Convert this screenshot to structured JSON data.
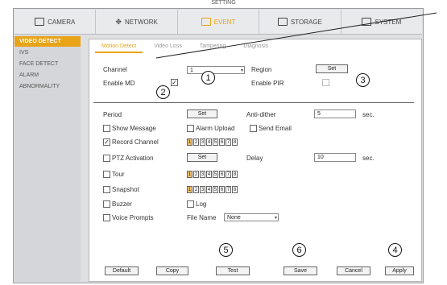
{
  "window_title": "SETTING",
  "top_tabs": [
    {
      "label": "CAMERA",
      "icon": "camera-icon",
      "active": false
    },
    {
      "label": "NETWORK",
      "icon": "network-icon",
      "active": false
    },
    {
      "label": "EVENT",
      "icon": "event-icon",
      "active": true
    },
    {
      "label": "STORAGE",
      "icon": "storage-icon",
      "active": false
    },
    {
      "label": "SYSTEM",
      "icon": "system-icon",
      "active": false
    }
  ],
  "sidebar": [
    {
      "label": "VIDEO DETECT",
      "active": true
    },
    {
      "label": "IVS",
      "active": false
    },
    {
      "label": "FACE DETECT",
      "active": false
    },
    {
      "label": "ALARM",
      "active": false
    },
    {
      "label": "ABNORMALITY",
      "active": false
    }
  ],
  "sub_tabs": [
    {
      "label": "Motion Detect",
      "active": true
    },
    {
      "label": "Video Loss",
      "active": false
    },
    {
      "label": "Tampering",
      "active": false
    },
    {
      "label": "Diagnosis",
      "active": false
    }
  ],
  "form": {
    "channel_label": "Channel",
    "channel_value": "1",
    "region_label": "Region",
    "region_button": "Set",
    "enable_md_label": "Enable MD",
    "enable_md_checked": "✓",
    "enable_pir_label": "Enable PIR",
    "period_label": "Period",
    "period_button": "Set",
    "anti_dither_label": "Anti-dither",
    "anti_dither_value": "5",
    "anti_dither_unit": "sec.",
    "show_message_label": "Show Message",
    "alarm_upload_label": "Alarm Upload",
    "send_email_label": "Send Email",
    "record_channel_label": "Record Channel",
    "record_channel_checked": "✓",
    "ptz_activation_label": "PTZ Activation",
    "ptz_button": "Set",
    "delay_label": "Delay",
    "delay_value": "10",
    "delay_unit": "sec.",
    "tour_label": "Tour",
    "snapshot_label": "Snapshot",
    "buzzer_label": "Buzzer",
    "log_label": "Log",
    "voice_prompts_label": "Voice Prompts",
    "file_name_label": "File Name",
    "file_name_value": "None"
  },
  "channels": [
    "1",
    "2",
    "3",
    "4",
    "5",
    "6",
    "7",
    "8"
  ],
  "buttons": {
    "default": "Default",
    "copy": "Copy",
    "test": "Test",
    "save": "Save",
    "cancel": "Cancel",
    "apply": "Apply"
  },
  "callouts": [
    "1",
    "2",
    "3",
    "4",
    "5",
    "6"
  ]
}
